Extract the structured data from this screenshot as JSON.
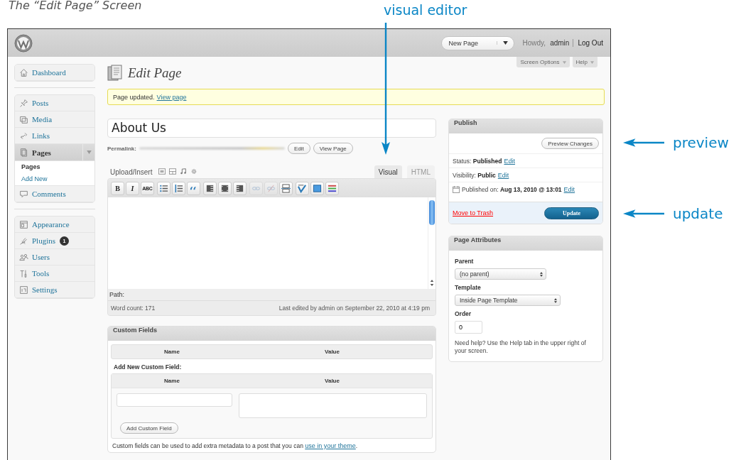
{
  "caption": "The “Edit Page” Screen",
  "callouts": [
    {
      "label": "visual editor",
      "kind": "down"
    },
    {
      "label": "preview",
      "kind": "left"
    },
    {
      "label": "update",
      "kind": "left"
    }
  ],
  "header": {
    "new_page_button": "New Page",
    "greeting": "Howdy,",
    "user": "admin",
    "logout": "Log Out"
  },
  "screen_tabs": [
    "Screen Options",
    "Help"
  ],
  "sidebar": {
    "groups": [
      [
        {
          "label": "Dashboard",
          "selected": false
        }
      ],
      [
        {
          "label": "Posts",
          "selected": false
        },
        {
          "label": "Media",
          "selected": false
        },
        {
          "label": "Links",
          "selected": false
        },
        {
          "label": "Pages",
          "selected": true,
          "children": [
            {
              "label": "Pages",
              "selected": true
            },
            {
              "label": "Add New",
              "selected": false
            }
          ]
        },
        {
          "label": "Comments",
          "selected": false
        }
      ],
      [
        {
          "label": "Appearance",
          "selected": false
        },
        {
          "label": "Plugins",
          "selected": false,
          "badge": "1"
        },
        {
          "label": "Users",
          "selected": false
        },
        {
          "label": "Tools",
          "selected": false
        },
        {
          "label": "Settings",
          "selected": false
        }
      ]
    ]
  },
  "page_title": "Edit Page",
  "notice": {
    "text": "Page updated.",
    "link": "View page"
  },
  "title_field": {
    "value": "About Us"
  },
  "permalink": {
    "label": "Permalink:",
    "buttons": [
      "Edit",
      "View Page"
    ]
  },
  "upload_label": "Upload/Insert",
  "editor_tabs": [
    {
      "label": "Visual",
      "selected": true
    },
    {
      "label": "HTML",
      "selected": false
    }
  ],
  "toolbar": [
    [
      {
        "kind": "bold",
        "glyph": "B",
        "disabled": false
      },
      {
        "kind": "italic",
        "glyph": "I",
        "disabled": false
      },
      {
        "kind": "strikethrough",
        "glyph": "ABC",
        "disabled": false
      }
    ],
    [
      {
        "kind": "bullets",
        "disabled": false
      },
      {
        "kind": "numbers",
        "disabled": false
      },
      {
        "kind": "quote",
        "disabled": false
      }
    ],
    [
      {
        "kind": "align-left",
        "disabled": false
      },
      {
        "kind": "align-center",
        "disabled": false
      },
      {
        "kind": "align-right",
        "disabled": false
      }
    ],
    [
      {
        "kind": "link",
        "disabled": true
      },
      {
        "kind": "unlink",
        "disabled": true
      },
      {
        "kind": "more",
        "disabled": false
      }
    ],
    [
      {
        "kind": "spellcheck",
        "disabled": false
      },
      {
        "kind": "fullscreen",
        "disabled": false
      },
      {
        "kind": "kitchen-sink",
        "disabled": false
      }
    ]
  ],
  "editor_path": "Path:",
  "word_count": "Word count: 171",
  "last_edited": "Last edited by admin on September 22, 2010 at 4:19 pm",
  "custom_fields": {
    "title": "Custom Fields",
    "columns": [
      "Name",
      "Value"
    ],
    "add_new_label": "Add New Custom Field:",
    "new_columns": [
      "Name",
      "Value"
    ],
    "button": "Add Custom Field",
    "help": "Custom fields can be used to add extra metadata to a post that you can ",
    "help_link": "use in your theme",
    "help_end": "."
  },
  "publish": {
    "title": "Publish",
    "preview_button": "Preview Changes",
    "rows": [
      {
        "kind": "status",
        "label": "Status:",
        "value": "Published",
        "link": "Edit"
      },
      {
        "kind": "visibility",
        "label": "Visibility:",
        "value": "Public",
        "link": "Edit"
      },
      {
        "kind": "schedule",
        "label": "Published on:",
        "value": "Aug 13, 2010 @ 13:01",
        "link": "Edit"
      }
    ],
    "trash_link": "Move to Trash",
    "update_button": "Update"
  },
  "page_attributes": {
    "title": "Page Attributes",
    "parent_label": "Parent",
    "parent_value": "(no parent)",
    "template_label": "Template",
    "template_value": "Inside Page Template",
    "order_label": "Order",
    "order_value": "0",
    "help": "Need help? Use the Help tab in the upper right of your screen."
  }
}
